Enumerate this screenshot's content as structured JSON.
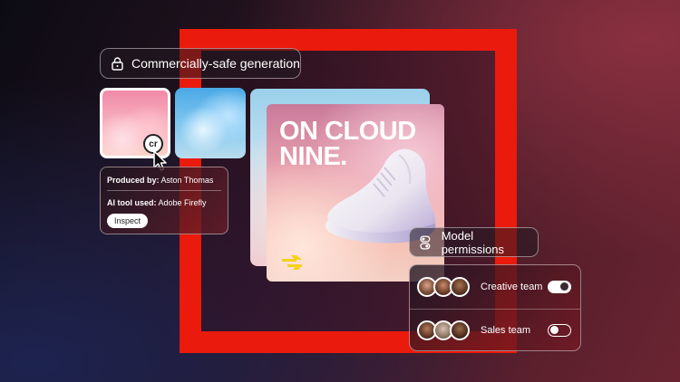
{
  "badge": {
    "label": "Commercially-safe generation",
    "icon": "lock-icon"
  },
  "content_credentials": {
    "badge_text": "cr",
    "produced_by_label": "Produced by:",
    "produced_by_value": "Aston Thomas",
    "ai_tool_label": "AI tool used:",
    "ai_tool_value": "Adobe Firefly",
    "inspect_label": "Inspect"
  },
  "ad": {
    "headline_line1": "ON CLOUD",
    "headline_line2": "NINE."
  },
  "model_permissions": {
    "label": "Model permissions",
    "icon": "toggle-icon"
  },
  "teams": [
    {
      "name": "Creative team",
      "enabled": true
    },
    {
      "name": "Sales team",
      "enabled": false
    }
  ],
  "colors": {
    "accent_red": "#ea1a0c"
  }
}
